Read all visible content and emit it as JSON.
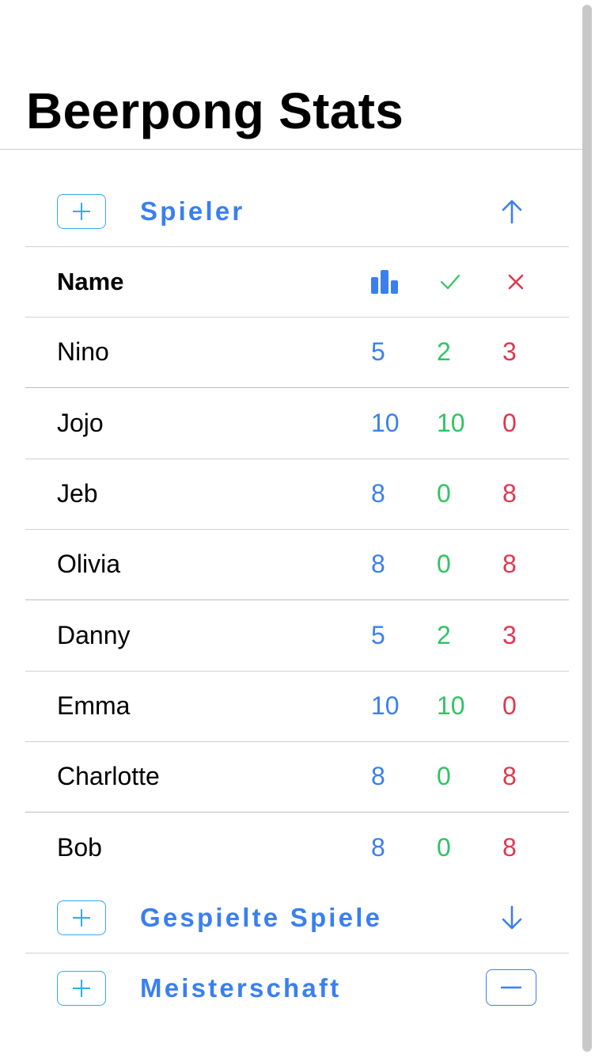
{
  "app": {
    "title": "Beerpong Stats"
  },
  "sections": {
    "players": {
      "label": "Spieler",
      "action_icon": "arrow-up-icon"
    },
    "games": {
      "label": "Gespielte Spiele",
      "action_icon": "arrow-down-icon"
    },
    "championship": {
      "label": "Meisterschaft",
      "action_icon": "minus-icon"
    }
  },
  "table": {
    "header": {
      "name": "Name",
      "total_icon": "bar-chart-icon",
      "wins_icon": "checkmark-icon",
      "losses_icon": "x-mark-icon"
    },
    "rows": [
      {
        "name": "Nino",
        "total": "5",
        "wins": "2",
        "losses": "3"
      },
      {
        "name": "Jojo",
        "total": "10",
        "wins": "10",
        "losses": "0"
      },
      {
        "name": "Jeb",
        "total": "8",
        "wins": "0",
        "losses": "8"
      },
      {
        "name": "Olivia",
        "total": "8",
        "wins": "0",
        "losses": "8"
      },
      {
        "name": "Danny",
        "total": "5",
        "wins": "2",
        "losses": "3"
      },
      {
        "name": "Emma",
        "total": "10",
        "wins": "10",
        "losses": "0"
      },
      {
        "name": "Charlotte",
        "total": "8",
        "wins": "0",
        "losses": "8"
      },
      {
        "name": "Bob",
        "total": "8",
        "wins": "0",
        "losses": "8"
      }
    ]
  },
  "colors": {
    "accent": "#3a7ff0",
    "add_border": "#33aaef",
    "win": "#2fc462",
    "loss": "#e0374f"
  }
}
